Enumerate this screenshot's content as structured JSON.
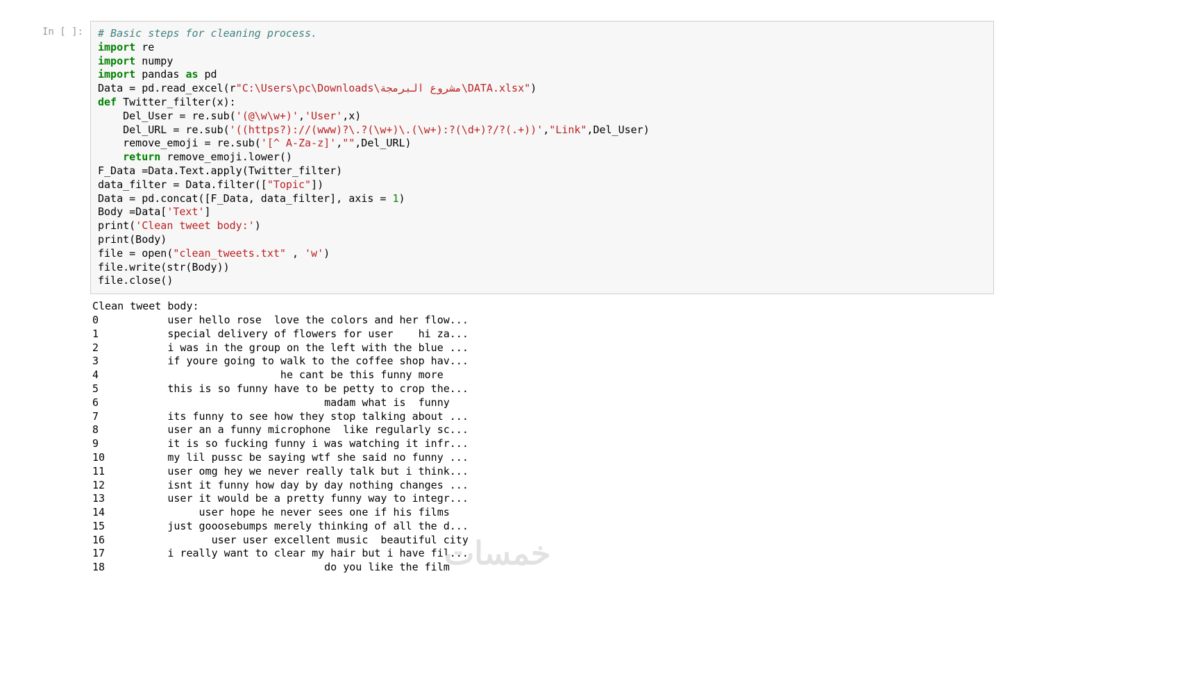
{
  "prompt_label": "In [ ]:",
  "code": {
    "l1_comment": "# Basic steps for cleaning process.",
    "l2_import": "import",
    "l2_re": " re",
    "l3_import": "import",
    "l3_numpy": " numpy",
    "l4_import": "import",
    "l4_pandas": " pandas ",
    "l4_as": "as",
    "l4_pd": " pd",
    "l5_a": "Data = pd.read_excel(",
    "l5_r": "r",
    "l5_s": "\"C:\\Users\\pc\\Downloads\\مشروع البرمجة\\DATA.xlsx\"",
    "l5_b": ")",
    "l6_def": "def",
    "l6_name": " Twitter_filter",
    "l6_rest": "(x):",
    "l7_a": "    Del_User = re.sub(",
    "l7_s1": "'(@\\w\\w+)'",
    "l7_c1": ",",
    "l7_s2": "'User'",
    "l7_b": ",x)",
    "l8_a": "    Del_URL = re.sub(",
    "l8_s1": "'((https?)://(www)?\\.?(\\w+)\\.(\\w+):?(\\d+)?/?(.+))'",
    "l8_c1": ",",
    "l8_s2": "\"Link\"",
    "l8_b": ",Del_User)",
    "l9_a": "    remove_emoji = re.sub(",
    "l9_s1": "'[^ A-Za-z]'",
    "l9_c1": ",",
    "l9_s2": "\"\"",
    "l9_b": ",Del_URL)",
    "l10_ind": "    ",
    "l10_return": "return",
    "l10_rest": " remove_emoji.lower()",
    "l11": "F_Data =Data.Text.apply(Twitter_filter)",
    "l12_a": "data_filter = Data.filter([",
    "l12_s": "\"Topic\"",
    "l12_b": "])",
    "l13_a": "Data = pd.concat([F_Data, data_filter], axis = ",
    "l13_n": "1",
    "l13_b": ")",
    "l14_a": "Body =Data[",
    "l14_s": "'Text'",
    "l14_b": "]",
    "l15_a": "print(",
    "l15_s": "'Clean tweet body:'",
    "l15_b": ")",
    "l16": "print(Body)",
    "l17_a": "file = open(",
    "l17_s1": "\"clean_tweets.txt\"",
    "l17_m": " , ",
    "l17_s2": "'w'",
    "l17_b": ")",
    "l18": "file.write(str(Body))",
    "l19": "file.close()"
  },
  "output_header": "Clean tweet body:",
  "output_rows": [
    {
      "idx": "0",
      "text": "     user hello rose  love the colors and her flow..."
    },
    {
      "idx": "1",
      "text": "     special delivery of flowers for user    hi za..."
    },
    {
      "idx": "2",
      "text": "     i was in the group on the left with the blue ..."
    },
    {
      "idx": "3",
      "text": "     if youre going to walk to the coffee shop hav..."
    },
    {
      "idx": "4",
      "text": "                       he cant be this funny more "
    },
    {
      "idx": "5",
      "text": "     this is so funny have to be petty to crop the..."
    },
    {
      "idx": "6",
      "text": "                              madam what is  funny"
    },
    {
      "idx": "7",
      "text": "     its funny to see how they stop talking about ..."
    },
    {
      "idx": "8",
      "text": "     user an a funny microphone  like regularly sc..."
    },
    {
      "idx": "9",
      "text": "     it is so fucking funny i was watching it infr..."
    },
    {
      "idx": "10",
      "text": "     my lil pussc be saying wtf she said no funny ..."
    },
    {
      "idx": "11",
      "text": "     user omg hey we never really talk but i think..."
    },
    {
      "idx": "12",
      "text": "     isnt it funny how day by day nothing changes ..."
    },
    {
      "idx": "13",
      "text": "     user it would be a pretty funny way to integr..."
    },
    {
      "idx": "14",
      "text": "          user hope he never sees one if his films"
    },
    {
      "idx": "15",
      "text": "     just gooosebumps merely thinking of all the d..."
    },
    {
      "idx": "16",
      "text": "            user user excellent music  beautiful city"
    },
    {
      "idx": "17",
      "text": "     i really want to clear my hair but i have fil..."
    },
    {
      "idx": "18",
      "text": "                              do you like the film"
    }
  ],
  "watermark": "خمسات"
}
